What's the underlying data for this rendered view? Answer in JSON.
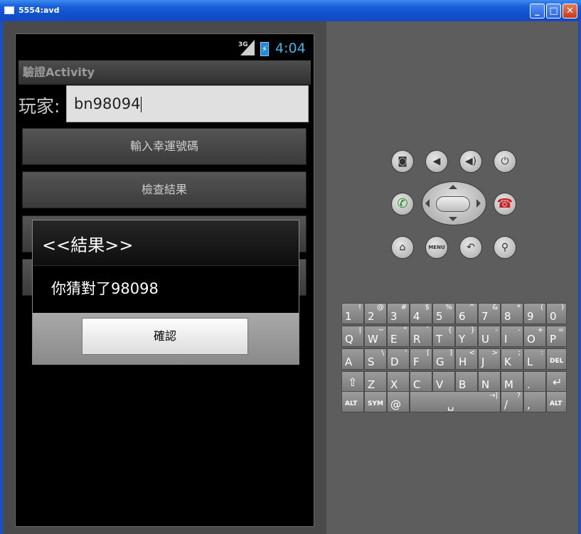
{
  "window": {
    "title": "5554:avd",
    "min": "_",
    "max": "□",
    "close": "✕"
  },
  "status": {
    "network": "3G",
    "time": "4:04"
  },
  "app": {
    "title": "驗證Activity",
    "player_label": "玩家:",
    "player_value": "bn98094",
    "buttons": [
      "輸入幸運號碼",
      "檢查結果",
      "",
      ""
    ]
  },
  "dialog": {
    "title": "<<結果>>",
    "message": "你猜對了98098",
    "ok": "確認"
  },
  "hw_buttons": {
    "camera": "camera-icon",
    "volume_down": "volume-down-icon",
    "volume_up": "volume-up-icon",
    "power": "power-icon",
    "call": "call-icon",
    "end_call": "end-call-icon",
    "home": "home-icon",
    "menu": "MENU",
    "back": "back-icon",
    "search": "search-icon"
  },
  "keyboard": {
    "row1": [
      [
        "1",
        "!"
      ],
      [
        "2",
        "@"
      ],
      [
        "3",
        "#"
      ],
      [
        "4",
        "$"
      ],
      [
        "5",
        "%"
      ],
      [
        "6",
        "^"
      ],
      [
        "7",
        "&"
      ],
      [
        "8",
        "*"
      ],
      [
        "9",
        "("
      ],
      [
        "0",
        ")"
      ]
    ],
    "row2": [
      [
        "Q",
        "|"
      ],
      [
        "W",
        "~"
      ],
      [
        "E",
        "\""
      ],
      [
        "R",
        "`"
      ],
      [
        "T",
        "{"
      ],
      [
        "Y",
        "}"
      ],
      [
        "U",
        "-"
      ],
      [
        "I",
        "-"
      ],
      [
        "O",
        "+"
      ],
      [
        "P",
        "="
      ]
    ],
    "row3": [
      [
        "A",
        ""
      ],
      [
        "S",
        "\\"
      ],
      [
        "D",
        "'"
      ],
      [
        "F",
        "["
      ],
      [
        "G",
        "]"
      ],
      [
        "H",
        "<"
      ],
      [
        "J",
        ">"
      ],
      [
        "K",
        ";"
      ],
      [
        "L",
        ":"
      ],
      [
        "DEL",
        ""
      ]
    ],
    "row4": [
      [
        "⇧",
        ""
      ],
      [
        "Z",
        ""
      ],
      [
        "X",
        ""
      ],
      [
        "C",
        ""
      ],
      [
        "V",
        ""
      ],
      [
        "B",
        ""
      ],
      [
        "N",
        ""
      ],
      [
        "M",
        ""
      ],
      [
        ".",
        ""
      ],
      [
        "↵",
        ""
      ]
    ],
    "row5": [
      [
        "ALT",
        ""
      ],
      [
        "SYM",
        ""
      ],
      [
        "@",
        ""
      ],
      [
        "␣",
        "→|"
      ],
      [
        "/",
        "?"
      ],
      [
        ",",
        ""
      ],
      [
        "ALT",
        ""
      ]
    ]
  }
}
